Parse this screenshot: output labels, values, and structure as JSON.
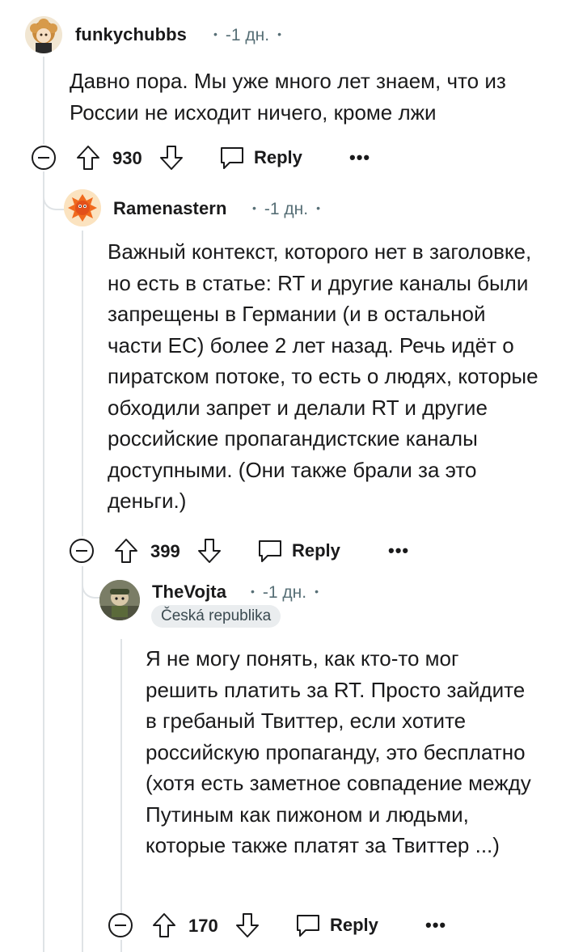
{
  "comments": [
    {
      "username": "funkychubbs",
      "time": "-1 дн.",
      "flair": "",
      "text": "Давно пора. Мы уже много лет знаем, что из России не исходит ничего, кроме лжи",
      "votes": "930",
      "reply_label": "Reply",
      "more_label": "•••"
    },
    {
      "username": "Ramenastern",
      "time": "-1 дн.",
      "flair": "",
      "text": "Важный контекст, которого нет в заголовке, но есть в статье: RT и другие каналы были запрещены в Германии (и в остальной части ЕС) более 2 лет назад. Речь идёт о пиратском потоке, то есть о людях, которые обходили запрет и делали RT и другие российские пропагандистские каналы доступными. (Они также брали за это деньги.)",
      "votes": "399",
      "reply_label": "Reply",
      "more_label": "•••"
    },
    {
      "username": "TheVojta",
      "time": "-1 дн.",
      "flair": "Česká republika",
      "text": "Я не могу понять, как кто-то мог решить платить за RT. Просто зайдите в гребаный Твиттер, если хотите российскую пропаганду, это бесплатно (хотя есть заметное совпадение между Путиным как пижоном и людьми, которые также платят за Твиттер ...)",
      "votes": "170",
      "reply_label": "Reply",
      "more_label": "•••"
    }
  ]
}
